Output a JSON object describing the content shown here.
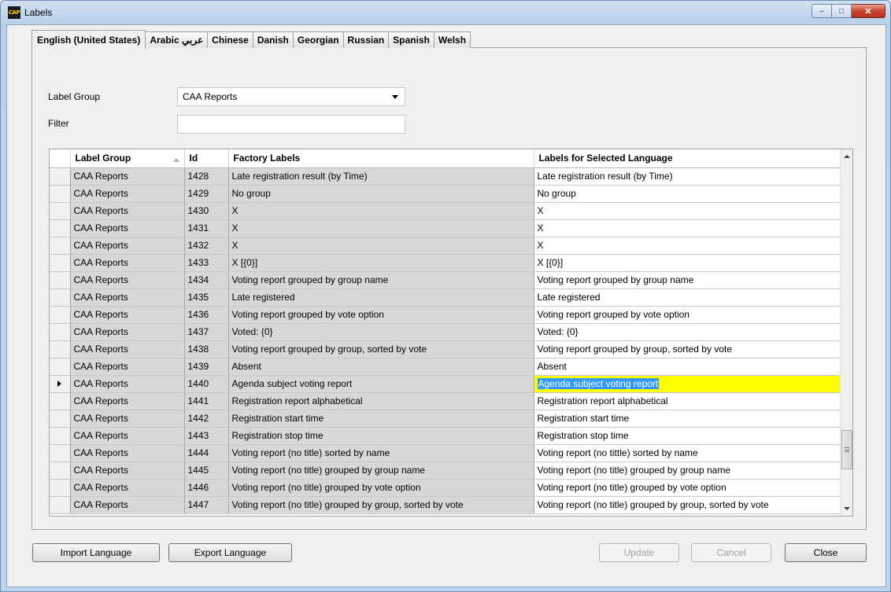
{
  "window": {
    "title": "Labels",
    "app_icon_text": "CAP"
  },
  "tabs": [
    {
      "label": "English (United States)",
      "active": true
    },
    {
      "label": "Arabic عربي",
      "active": false
    },
    {
      "label": "Chinese",
      "active": false
    },
    {
      "label": "Danish",
      "active": false
    },
    {
      "label": "Georgian",
      "active": false
    },
    {
      "label": "Russian",
      "active": false
    },
    {
      "label": "Spanish",
      "active": false
    },
    {
      "label": "Welsh",
      "active": false
    }
  ],
  "form": {
    "label_group_label": "Label Group",
    "label_group_value": "CAA Reports",
    "filter_label": "Filter",
    "filter_value": ""
  },
  "grid": {
    "columns": [
      "Label Group",
      "Id",
      "Factory Labels",
      "Labels for Selected Language"
    ],
    "sorted_column": "Label Group",
    "current_row_id": "1440",
    "rows": [
      {
        "group": "CAA Reports",
        "id": "1428",
        "factory": "Late registration result (by Time)",
        "lang": "Late registration result (by Time)"
      },
      {
        "group": "CAA Reports",
        "id": "1429",
        "factory": "No group",
        "lang": "No group"
      },
      {
        "group": "CAA Reports",
        "id": "1430",
        "factory": "X",
        "lang": "X"
      },
      {
        "group": "CAA Reports",
        "id": "1431",
        "factory": "X",
        "lang": "X"
      },
      {
        "group": "CAA Reports",
        "id": "1432",
        "factory": "X",
        "lang": "X"
      },
      {
        "group": "CAA Reports",
        "id": "1433",
        "factory": "X [{0}]",
        "lang": "X [{0}]"
      },
      {
        "group": "CAA Reports",
        "id": "1434",
        "factory": "Voting report grouped by group name",
        "lang": "Voting report grouped by group name"
      },
      {
        "group": "CAA Reports",
        "id": "1435",
        "factory": "Late registered",
        "lang": "Late registered"
      },
      {
        "group": "CAA Reports",
        "id": "1436",
        "factory": "Voting report grouped by vote option",
        "lang": "Voting report grouped by vote option"
      },
      {
        "group": "CAA Reports",
        "id": "1437",
        "factory": "Voted: {0}",
        "lang": "Voted: {0}"
      },
      {
        "group": "CAA Reports",
        "id": "1438",
        "factory": "Voting report grouped by group, sorted by vote",
        "lang": "Voting report grouped by group, sorted by vote"
      },
      {
        "group": "CAA Reports",
        "id": "1439",
        "factory": "Absent",
        "lang": "Absent"
      },
      {
        "group": "CAA Reports",
        "id": "1440",
        "factory": "Agenda subject voting report",
        "lang": "Agenda subject voting report"
      },
      {
        "group": "CAA Reports",
        "id": "1441",
        "factory": "Registration report alphabetical",
        "lang": "Registration report alphabetical"
      },
      {
        "group": "CAA Reports",
        "id": "1442",
        "factory": "Registration start time",
        "lang": "Registration start time"
      },
      {
        "group": "CAA Reports",
        "id": "1443",
        "factory": "Registration stop time",
        "lang": "Registration stop time"
      },
      {
        "group": "CAA Reports",
        "id": "1444",
        "factory": "Voting report (no title) sorted by name",
        "lang": "Voting report (no tittle) sorted by name"
      },
      {
        "group": "CAA Reports",
        "id": "1445",
        "factory": "Voting report (no title) grouped by group name",
        "lang": "Voting report (no title) grouped by group name"
      },
      {
        "group": "CAA Reports",
        "id": "1446",
        "factory": "Voting report (no title) grouped by vote option",
        "lang": "Voting report (no title) grouped by vote option"
      },
      {
        "group": "CAA Reports",
        "id": "1447",
        "factory": "Voting report (no title) grouped by group, sorted by vote",
        "lang": "Voting report (no title) grouped by group, sorted by vote"
      }
    ]
  },
  "buttons": {
    "import": "Import Language",
    "export": "Export Language",
    "update": "Update",
    "cancel": "Cancel",
    "close": "Close"
  },
  "colors": {
    "current_cell_bg": "#ffff00",
    "selection_bg": "#3399ff",
    "readonly_bg": "#d8d8d8"
  }
}
